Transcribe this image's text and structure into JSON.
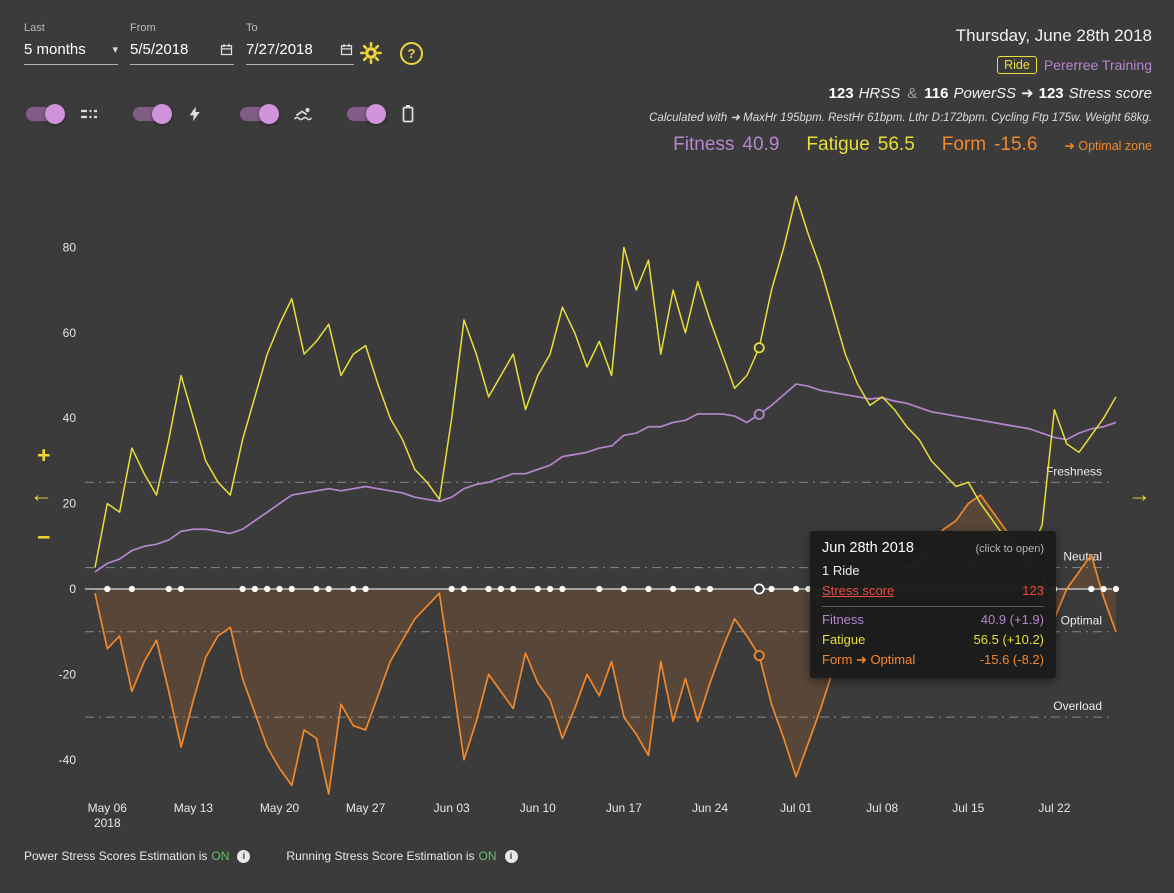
{
  "filters": {
    "last_label": "Last",
    "last_value": "5 months",
    "from_label": "From",
    "from_value": "5/5/2018",
    "to_label": "To",
    "to_value": "7/27/2018"
  },
  "icons": {
    "caret": "▾",
    "help": "?",
    "plus": "+",
    "minus": "−",
    "arrow_left": "←",
    "arrow_right": "→",
    "info": "i",
    "toggle_icons": [
      "zone-lines-icon",
      "lightning-icon",
      "swimmer-icon",
      "battery-icon"
    ]
  },
  "header": {
    "date_title": "Thursday, June 28th 2018",
    "activity_type": "Ride",
    "activity_name": "Pererree Training",
    "stress": {
      "hrss": "123",
      "hrss_label": "HRSS",
      "and": "&",
      "powerss": "116",
      "powerss_label": "PowerSS",
      "arrow": "➜",
      "total": "123",
      "total_label": "Stress score"
    },
    "calc_note": "Calculated with ➜ MaxHr 195bpm. RestHr 61bpm. Lthr D:172bpm. Cycling Ftp 175w. Weight 68kg.",
    "fitness_label": "Fitness",
    "fitness_value": "40.9",
    "fatigue_label": "Fatigue",
    "fatigue_value": "56.5",
    "form_label": "Form",
    "form_value": "-15.6",
    "zone_note": "➜ Optimal zone"
  },
  "tooltip": {
    "date": "Jun 28th 2018",
    "hint": "(click to open)",
    "activities": "1 Ride",
    "rows": [
      {
        "label": "Stress score",
        "value": "123"
      },
      {
        "label": "Fitness",
        "value": "40.9 (+1.9)"
      },
      {
        "label": "Fatigue",
        "value": "56.5 (+10.2)"
      },
      {
        "label": "Form ➜ Optimal",
        "value": "-15.6 (-8.2)"
      }
    ]
  },
  "footer": {
    "power_text": "Power Stress Scores Estimation is",
    "power_state": "ON",
    "running_text": "Running Stress Score Estimation is",
    "running_state": "ON"
  },
  "chart_data": {
    "type": "line",
    "ylim": [
      -50,
      95
    ],
    "y_ticks": [
      80,
      60,
      40,
      20,
      0,
      -20,
      -40
    ],
    "x_ticks": [
      {
        "day": 1,
        "label": "May 06",
        "sub": "2018"
      },
      {
        "day": 8,
        "label": "May 13"
      },
      {
        "day": 15,
        "label": "May 20"
      },
      {
        "day": 22,
        "label": "May 27"
      },
      {
        "day": 29,
        "label": "Jun 03"
      },
      {
        "day": 36,
        "label": "Jun 10"
      },
      {
        "day": 43,
        "label": "Jun 17"
      },
      {
        "day": 50,
        "label": "Jun 24"
      },
      {
        "day": 57,
        "label": "Jul 01"
      },
      {
        "day": 64,
        "label": "Jul 08"
      },
      {
        "day": 71,
        "label": "Jul 15"
      },
      {
        "day": 78,
        "label": "Jul 22"
      }
    ],
    "zones": [
      {
        "label": "Freshness",
        "value": 25
      },
      {
        "label": "Neutral",
        "value": 5
      },
      {
        "label": "Optimal",
        "value": -10
      },
      {
        "label": "Overload",
        "value": -30
      }
    ],
    "series": [
      {
        "name": "Fitness",
        "color": "#b487cd",
        "values": [
          4,
          6,
          7,
          9,
          10,
          10.5,
          11.5,
          13.5,
          14,
          14,
          13.5,
          13,
          14,
          16,
          18,
          20,
          22,
          22.5,
          23,
          23.5,
          23,
          23.5,
          24,
          23.5,
          23,
          22.5,
          21.5,
          21,
          20.5,
          21.5,
          23.5,
          24.5,
          25,
          26,
          27,
          27,
          28,
          29,
          31,
          31.5,
          32,
          33,
          33.5,
          36,
          36.5,
          38,
          38,
          39,
          39.5,
          41,
          41,
          41,
          40.5,
          39,
          40.9,
          43,
          45.5,
          48,
          47.5,
          46.5,
          46,
          45.5,
          45,
          44.5,
          44.8,
          44,
          43.5,
          42.5,
          41.5,
          41,
          40.5,
          40,
          39.5,
          39,
          38.5,
          38,
          37.5,
          36.5,
          35.5,
          35,
          36.5,
          37.5,
          38,
          39
        ]
      },
      {
        "name": "Fatigue",
        "color": "#e8df3a",
        "values": [
          5,
          20,
          18,
          33,
          27,
          22,
          35,
          50,
          40,
          30,
          25,
          22,
          35,
          45,
          55,
          62,
          68,
          55,
          58,
          62,
          50,
          55,
          57,
          48,
          40,
          35,
          28,
          25,
          21,
          40,
          63,
          55,
          45,
          50,
          55,
          42,
          50,
          55,
          66,
          60,
          52,
          58,
          50,
          80,
          70,
          77,
          55,
          70,
          60,
          72,
          63,
          55,
          47,
          50,
          56.5,
          70,
          80,
          92,
          83,
          75,
          65,
          55,
          48,
          43,
          45,
          42,
          38,
          35,
          30,
          27,
          24,
          25,
          20,
          16,
          12,
          10,
          8,
          15,
          42,
          34,
          32,
          36,
          40,
          45
        ]
      },
      {
        "name": "Form",
        "color": "#f2872b",
        "fill": "rgba(242,135,43,0.16)",
        "values": [
          -1,
          -14,
          -11,
          -24,
          -17,
          -12,
          -24,
          -37,
          -26,
          -16,
          -11,
          -9,
          -21,
          -29,
          -37,
          -42,
          -46,
          -33,
          -35,
          -48,
          -27,
          -32,
          -33,
          -25,
          -17,
          -12,
          -7,
          -4,
          -1,
          -20,
          -40,
          -31,
          -20,
          -24,
          -28,
          -15,
          -22,
          -26,
          -35,
          -28,
          -20,
          -25,
          -17,
          -30,
          -34,
          -39,
          -17,
          -31,
          -21,
          -31,
          -22,
          -14,
          -7,
          -11,
          -15.6,
          -27,
          -35,
          -44,
          -36,
          -28,
          -19,
          -10,
          -3,
          1.5,
          -0.2,
          2,
          5,
          7,
          11,
          14,
          16,
          20,
          22,
          18,
          14,
          10,
          6,
          4,
          -7,
          0,
          4,
          8,
          -2,
          -10
        ]
      }
    ],
    "activity_days": [
      1,
      3,
      6,
      7,
      12,
      13,
      14,
      15,
      16,
      18,
      19,
      21,
      22,
      29,
      30,
      32,
      33,
      34,
      36,
      37,
      38,
      41,
      43,
      45,
      47,
      49,
      50,
      54,
      55,
      57,
      58,
      64,
      77,
      78,
      81,
      82,
      83
    ],
    "selected_day": 54
  }
}
